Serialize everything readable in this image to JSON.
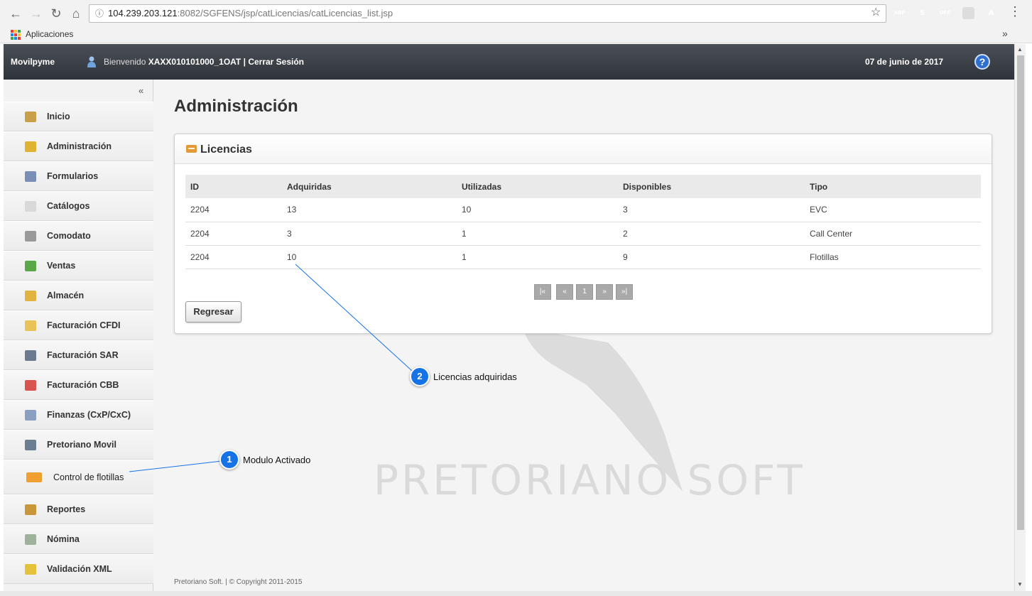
{
  "browser": {
    "address": {
      "info_icon": "ⓘ",
      "host": "104.239.203.121",
      "path": ":8082/SGFENS/jsp/catLicencias/catLicencias_list.jsp"
    },
    "extensions": [
      {
        "name": "adblock-plus",
        "label": "ABP",
        "color": "#d0021b"
      },
      {
        "name": "skype",
        "label": "S",
        "color": "#00aff0"
      },
      {
        "name": "off",
        "label": "OFF",
        "color": "#555555"
      },
      {
        "name": "pdf",
        "label": "A",
        "color": "#b30b00"
      }
    ],
    "bookmarks": {
      "apps_label": "Aplicaciones"
    }
  },
  "header": {
    "brand": "Movilpyme",
    "welcome_prefix": "Bienvenido",
    "user": "XAXX010101000_1OAT",
    "separator": "|",
    "logout": "Cerrar Sesión",
    "date": "07 de junio de 2017",
    "help_label": "?"
  },
  "sidebar": {
    "collapse_label": "«",
    "items": [
      {
        "label": "Inicio",
        "icon": "home-icon",
        "color": "#c8a04a"
      },
      {
        "label": "Administración",
        "icon": "admin-icon",
        "color": "#e0b232"
      },
      {
        "label": "Formularios",
        "icon": "forms-icon",
        "color": "#7a8fb5"
      },
      {
        "label": "Catálogos",
        "icon": "catalog-icon",
        "color": "#d9d9d9"
      },
      {
        "label": "Comodato",
        "icon": "comodato-icon",
        "color": "#999999"
      },
      {
        "label": "Ventas",
        "icon": "sales-icon",
        "color": "#5aa847"
      },
      {
        "label": "Almacén",
        "icon": "warehouse-icon",
        "color": "#e3b341"
      },
      {
        "label": "Facturación CFDI",
        "icon": "invoice-cfdi-icon",
        "color": "#e8c35a"
      },
      {
        "label": "Facturación SAR",
        "icon": "invoice-sar-icon",
        "color": "#6b7a8f"
      },
      {
        "label": "Facturación CBB",
        "icon": "invoice-cbb-icon",
        "color": "#d9534f"
      },
      {
        "label": "Finanzas (CxP/CxC)",
        "icon": "finance-icon",
        "color": "#8aa0c0"
      },
      {
        "label": "Pretoriano Movil",
        "icon": "mobile-icon",
        "color": "#6d7d91"
      },
      {
        "label": "Control de flotillas",
        "icon": "truck-icon",
        "color": "#f0a030"
      },
      {
        "label": "Reportes",
        "icon": "reports-icon",
        "color": "#c9973a"
      },
      {
        "label": "Nómina",
        "icon": "payroll-icon",
        "color": "#9db39a"
      },
      {
        "label": "Validación XML",
        "icon": "xml-validation-icon",
        "color": "#e6c23a"
      }
    ]
  },
  "main": {
    "page_title": "Administración",
    "watermark": "PRETORIANO SOFT",
    "panel_title": "Licencias",
    "table": {
      "headers": [
        "ID",
        "Adquiridas",
        "Utilizadas",
        "Disponibles",
        "Tipo"
      ],
      "rows": [
        [
          "2204",
          "13",
          "10",
          "3",
          "EVC"
        ],
        [
          "2204",
          "3",
          "1",
          "2",
          "Call Center"
        ],
        [
          "2204",
          "10",
          "1",
          "9",
          "Flotillas"
        ]
      ]
    },
    "pager": [
      "|«",
      "«",
      "1",
      "»",
      "»|"
    ],
    "back_label": "Regresar",
    "footer": "Pretoriano Soft. | © Copyright 2011-2015"
  },
  "callouts": [
    {
      "number": "1",
      "text": "Modulo Activado"
    },
    {
      "number": "2",
      "text": "Licencias adquiridas"
    }
  ],
  "colors": {
    "header_dark": "#2f343a",
    "callout_blue": "#1673e6",
    "pager_gray": "#a9a9a9"
  }
}
